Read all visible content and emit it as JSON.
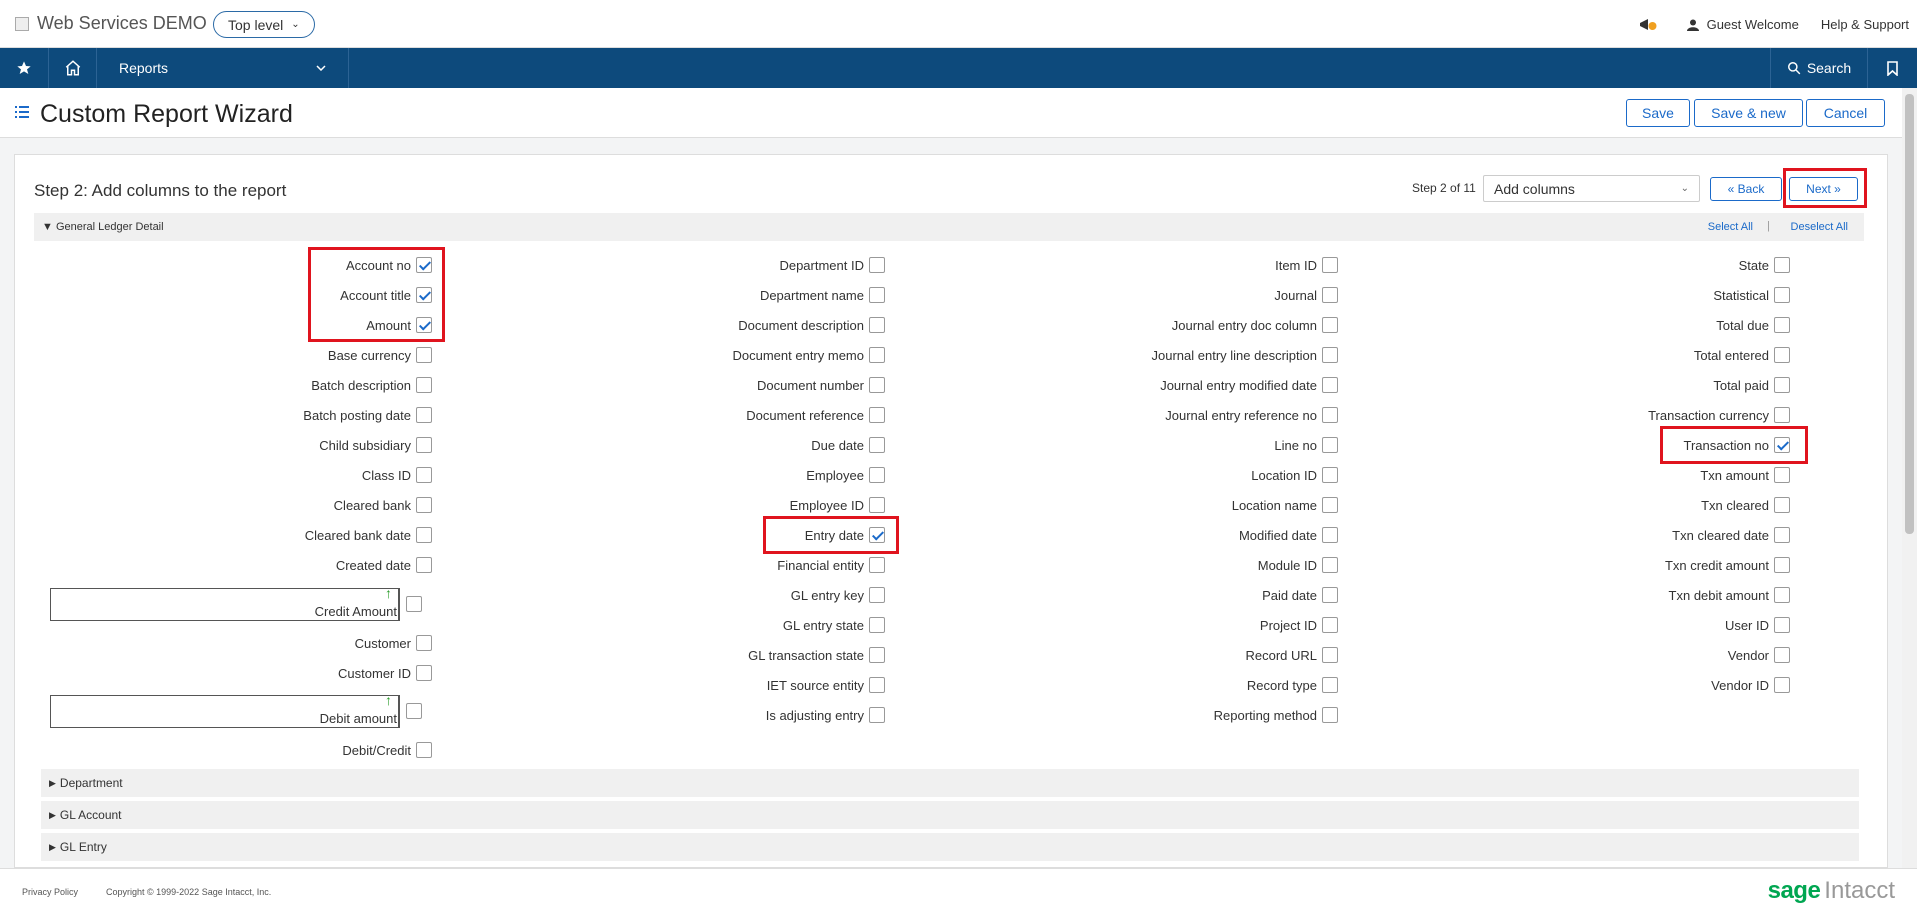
{
  "header": {
    "app_title": "Web Services DEMO",
    "level_selector": "Top level",
    "guest_label": "Guest Welcome",
    "help_label": "Help & Support",
    "notification_badge": "1"
  },
  "nav": {
    "reports_label": "Reports",
    "search_label": "Search"
  },
  "page": {
    "title": "Custom Report Wizard",
    "buttons": {
      "save": "Save",
      "save_new": "Save & new",
      "cancel": "Cancel"
    }
  },
  "wizard": {
    "step_title": "Step 2: Add columns to the report",
    "step_of": "Step 2 of 11",
    "step_select": "Add columns",
    "back_label": "« Back",
    "next_label": "Next »"
  },
  "section": {
    "title": "General Ledger Detail",
    "select_all": "Select All",
    "separator": "|",
    "deselect_all": "Deselect All"
  },
  "columns": {
    "col1": [
      {
        "label": "Account no",
        "checked": true
      },
      {
        "label": "Account title",
        "checked": true
      },
      {
        "label": "Amount",
        "checked": true
      },
      {
        "label": "Base currency",
        "checked": false
      },
      {
        "label": "Batch description",
        "checked": false
      },
      {
        "label": "Batch posting date",
        "checked": false
      },
      {
        "label": "Child subsidiary",
        "checked": false
      },
      {
        "label": "Class ID",
        "checked": false
      },
      {
        "label": "Cleared bank",
        "checked": false
      },
      {
        "label": "Cleared bank date",
        "checked": false
      },
      {
        "label": "Created date",
        "checked": false
      }
    ],
    "col1_formula_1": "Credit Amount",
    "col1_mid": [
      {
        "label": "Customer",
        "checked": false
      },
      {
        "label": "Customer ID",
        "checked": false
      }
    ],
    "col1_formula_2": "Debit amount",
    "col1_last": {
      "label": "Debit/Credit",
      "checked": false
    },
    "col2": [
      {
        "label": "Department ID",
        "checked": false
      },
      {
        "label": "Department name",
        "checked": false
      },
      {
        "label": "Document description",
        "checked": false
      },
      {
        "label": "Document entry memo",
        "checked": false
      },
      {
        "label": "Document number",
        "checked": false
      },
      {
        "label": "Document reference",
        "checked": false
      },
      {
        "label": "Due date",
        "checked": false
      },
      {
        "label": "Employee",
        "checked": false
      },
      {
        "label": "Employee ID",
        "checked": false
      },
      {
        "label": "Entry date",
        "checked": true
      },
      {
        "label": "Financial entity",
        "checked": false
      },
      {
        "label": "GL entry key",
        "checked": false
      },
      {
        "label": "GL entry state",
        "checked": false
      },
      {
        "label": "GL transaction state",
        "checked": false
      },
      {
        "label": "IET source entity",
        "checked": false
      },
      {
        "label": "Is adjusting entry",
        "checked": false
      }
    ],
    "col3": [
      {
        "label": "Item ID",
        "checked": false
      },
      {
        "label": "Journal",
        "checked": false
      },
      {
        "label": "Journal entry doc column",
        "checked": false
      },
      {
        "label": "Journal entry line description",
        "checked": false
      },
      {
        "label": "Journal entry modified date",
        "checked": false
      },
      {
        "label": "Journal entry reference no",
        "checked": false
      },
      {
        "label": "Line no",
        "checked": false
      },
      {
        "label": "Location ID",
        "checked": false
      },
      {
        "label": "Location name",
        "checked": false
      },
      {
        "label": "Modified date",
        "checked": false
      },
      {
        "label": "Module ID",
        "checked": false
      },
      {
        "label": "Paid date",
        "checked": false
      },
      {
        "label": "Project ID",
        "checked": false
      },
      {
        "label": "Record URL",
        "checked": false
      },
      {
        "label": "Record type",
        "checked": false
      },
      {
        "label": "Reporting method",
        "checked": false
      }
    ],
    "col4": [
      {
        "label": "State",
        "checked": false
      },
      {
        "label": "Statistical",
        "checked": false
      },
      {
        "label": "Total due",
        "checked": false
      },
      {
        "label": "Total entered",
        "checked": false
      },
      {
        "label": "Total paid",
        "checked": false
      },
      {
        "label": "Transaction currency",
        "checked": false
      },
      {
        "label": "Transaction no",
        "checked": true
      },
      {
        "label": "Txn amount",
        "checked": false
      },
      {
        "label": "Txn cleared",
        "checked": false
      },
      {
        "label": "Txn cleared date",
        "checked": false
      },
      {
        "label": "Txn credit amount",
        "checked": false
      },
      {
        "label": "Txn debit amount",
        "checked": false
      },
      {
        "label": "User ID",
        "checked": false
      },
      {
        "label": "Vendor",
        "checked": false
      },
      {
        "label": "Vendor ID",
        "checked": false
      }
    ]
  },
  "collapsed_sections": [
    "Department",
    "GL Account",
    "GL Entry"
  ],
  "footer": {
    "privacy": "Privacy Policy",
    "copyright": "Copyright © 1999-2022 Sage Intacct, Inc.",
    "logo_sage": "sage",
    "logo_intacct": "Intacct"
  },
  "colors": {
    "nav_bg": "#0d4a7c",
    "accent_blue": "#1b6ac9",
    "highlight_red": "#e0141e",
    "brand_green": "#00a651"
  }
}
